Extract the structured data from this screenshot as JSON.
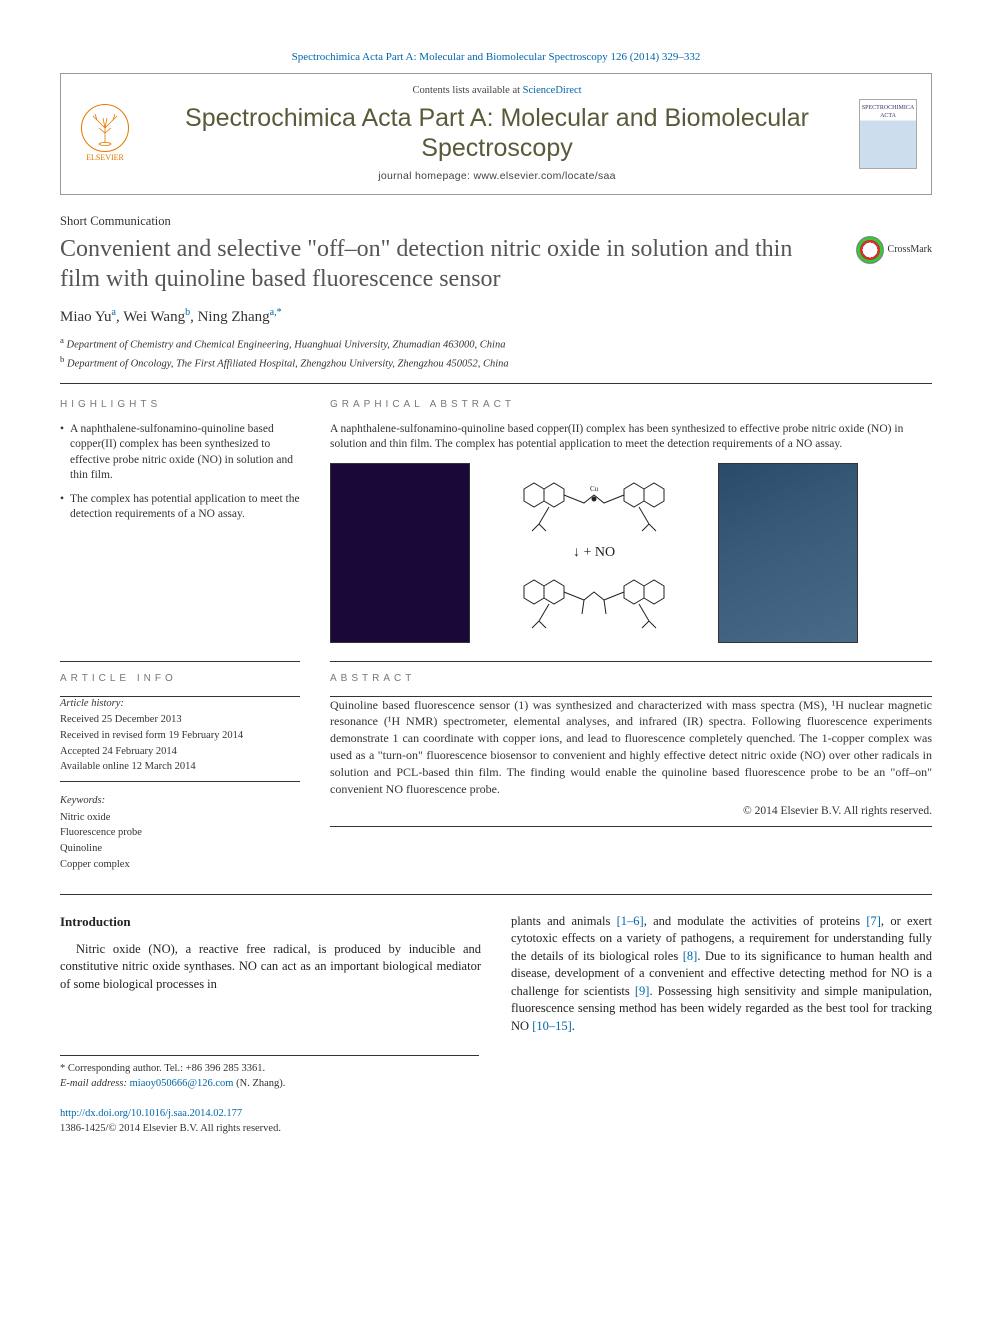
{
  "header_link": "Spectrochimica Acta Part A: Molecular and Biomolecular Spectroscopy 126 (2014) 329–332",
  "contents_line_prefix": "Contents lists available at ",
  "contents_line_link": "ScienceDirect",
  "journal_name": "Spectrochimica Acta Part A: Molecular and Biomolecular Spectroscopy",
  "journal_homepage": "journal homepage: www.elsevier.com/locate/saa",
  "elsevier_label": "ELSEVIER",
  "thumb_label": "SPECTROCHIMICA ACTA",
  "article_type": "Short Communication",
  "title": "Convenient and selective \"off–on\" detection nitric oxide in solution and thin film with quinoline based fluorescence sensor",
  "crossmark_label": "CrossMark",
  "authors": [
    {
      "name": "Miao Yu",
      "aff": "a"
    },
    {
      "name": "Wei Wang",
      "aff": "b"
    },
    {
      "name": "Ning Zhang",
      "aff": "a,",
      "corr": "*"
    }
  ],
  "affiliations": {
    "a": "Department of Chemistry and Chemical Engineering, Huanghuai University, Zhumadian 463000, China",
    "b": "Department of Oncology, The First Affiliated Hospital, Zhengzhou University, Zhengzhou 450052, China"
  },
  "highlights_head": "HIGHLIGHTS",
  "highlights": [
    "A naphthalene-sulfonamino-quinoline based copper(II) complex has been synthesized to effective probe nitric oxide (NO) in solution and thin film.",
    "The complex has potential application to meet the detection requirements of a NO assay."
  ],
  "graphical_head": "GRAPHICAL ABSTRACT",
  "graphical_text": "A naphthalene-sulfonamino-quinoline based copper(II) complex has been synthesized to effective probe nitric oxide (NO) in solution and thin film. The complex has potential application to meet the detection requirements of a NO assay.",
  "reaction_label": "+ NO",
  "article_info_head": "ARTICLE INFO",
  "article_history_head": "Article history:",
  "article_history": [
    "Received 25 December 2013",
    "Received in revised form 19 February 2014",
    "Accepted 24 February 2014",
    "Available online 12 March 2014"
  ],
  "keywords_head": "Keywords:",
  "keywords": [
    "Nitric oxide",
    "Fluorescence probe",
    "Quinoline",
    "Copper complex"
  ],
  "abstract_head": "ABSTRACT",
  "abstract_text": "Quinoline based fluorescence sensor (1) was synthesized and characterized with mass spectra (MS), ¹H nuclear magnetic resonance (¹H NMR) spectrometer, elemental analyses, and infrared (IR) spectra. Following fluorescence experiments demonstrate 1 can coordinate with copper ions, and lead to fluorescence completely quenched. The 1-copper complex was used as a \"turn-on\" fluorescence biosensor to convenient and highly effective detect nitric oxide (NO) over other radicals in solution and PCL-based thin film. The finding would enable the quinoline based fluorescence probe to be an \"off–on\" convenient NO fluorescence probe.",
  "copyright": "© 2014 Elsevier B.V. All rights reserved.",
  "intro_head": "Introduction",
  "intro_p1": "Nitric oxide (NO), a reactive free radical, is produced by inducible and constitutive nitric oxide synthases. NO can act as an important biological mediator of some biological processes in",
  "intro_p2_a": "plants and animals ",
  "cite1": "[1–6]",
  "intro_p2_b": ", and modulate the activities of proteins ",
  "cite2": "[7]",
  "intro_p2_c": ", or exert cytotoxic effects on a variety of pathogens, a requirement for understanding fully the details of its biological roles ",
  "cite3": "[8]",
  "intro_p2_d": ". Due to its significance to human health and disease, development of a convenient and effective detecting method for NO is a challenge for scientists ",
  "cite4": "[9]",
  "intro_p2_e": ". Possessing high sensitivity and simple manipulation, fluorescence sensing method has been widely regarded as the best tool for tracking NO ",
  "cite5": "[10–15]",
  "intro_p2_f": ".",
  "corr_note_symbol": "*",
  "corr_note": "Corresponding author. Tel.: +86 396 285 3361.",
  "email_label": "E-mail address: ",
  "email": "miaoy050666@126.com",
  "email_owner": " (N. Zhang).",
  "doi": "http://dx.doi.org/10.1016/j.saa.2014.02.177",
  "issn_line": "1386-1425/© 2014 Elsevier B.V. All rights reserved."
}
